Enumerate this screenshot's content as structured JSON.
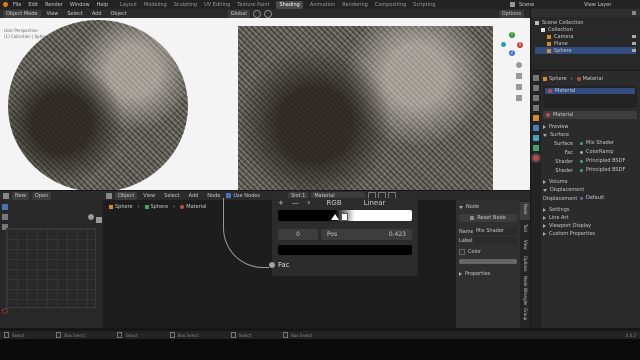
{
  "top_menu": [
    "File",
    "Edit",
    "Render",
    "Window",
    "Help"
  ],
  "workspaces": [
    "Layout",
    "Modeling",
    "Sculpting",
    "UV Editing",
    "Texture Paint",
    "Shading",
    "Animation",
    "Rendering",
    "Compositing",
    "Scripting"
  ],
  "active_workspace": "Shading",
  "scene": "Scene",
  "view_layer": "View Layer",
  "viewport_header": {
    "mode": "Object Mode",
    "view": "View",
    "select": "Select",
    "add": "Add",
    "object": "Object",
    "orientation": "Global",
    "options": "Options"
  },
  "viewport_overlay_text": [
    "User Perspective",
    "(1) Collection | Sphere"
  ],
  "nav_gizmo": {
    "y": "Y",
    "x": "X",
    "z": "Z"
  },
  "image_editor_header": {
    "new": "New",
    "open": "Open"
  },
  "node_header": {
    "object": "Object",
    "view": "View",
    "select": "Select",
    "add": "Add",
    "node": "Node",
    "use_nodes": "Use Nodes",
    "slot": "Slot 1",
    "material": "Material"
  },
  "breadcrumbs": [
    "Sphere",
    "Sphere",
    "Material"
  ],
  "colorramp": {
    "color_mode": "RGB",
    "interpolation": "Linear",
    "index": "0",
    "pos_label": "Pos",
    "pos_value": "0.423",
    "output_label": "Fac"
  },
  "node_panel": {
    "tab_label": "Node",
    "reset_label": "Reset Node",
    "name_label": "Name",
    "name_value": "Mix Shader",
    "label_label": "Label",
    "color_label": "Color",
    "properties_label": "Properties"
  },
  "side_tabs": [
    "Node",
    "Tool",
    "View",
    "Options",
    "Node Wrangler",
    "Group"
  ],
  "outliner": {
    "title": "Scene Collection",
    "items": [
      "Collection",
      "Camera",
      "Plane",
      "Sphere"
    ]
  },
  "properties": {
    "breadcrumb": [
      "Sphere",
      "Material"
    ],
    "material_name": "Material",
    "sections": {
      "preview": "Preview",
      "surface": "Surface",
      "volume": "Volume",
      "displacement": "Displacement",
      "settings": "Settings",
      "line_art": "Line Art",
      "viewport_display": "Viewport Display",
      "custom_properties": "Custom Properties"
    },
    "surface_rows": [
      {
        "label": "Surface",
        "value": "Mix Shader"
      },
      {
        "label": "Fac",
        "value": "ColorRamp"
      },
      {
        "label": "Shader",
        "value": "Principled BSDF"
      },
      {
        "label": "Shader",
        "value": "Principled BSDF"
      }
    ],
    "displacement": {
      "label": "Displacement",
      "value": "Default"
    }
  },
  "status_bar": [
    "Select",
    "Box Select",
    "Select",
    "Box Select",
    "Select",
    "Box Select"
  ],
  "version": "4.0.2",
  "colors": {
    "accent": "#4772b3",
    "active_tab": "#4a4a4a",
    "panel": "#303030",
    "node": "#2c2c2c"
  }
}
